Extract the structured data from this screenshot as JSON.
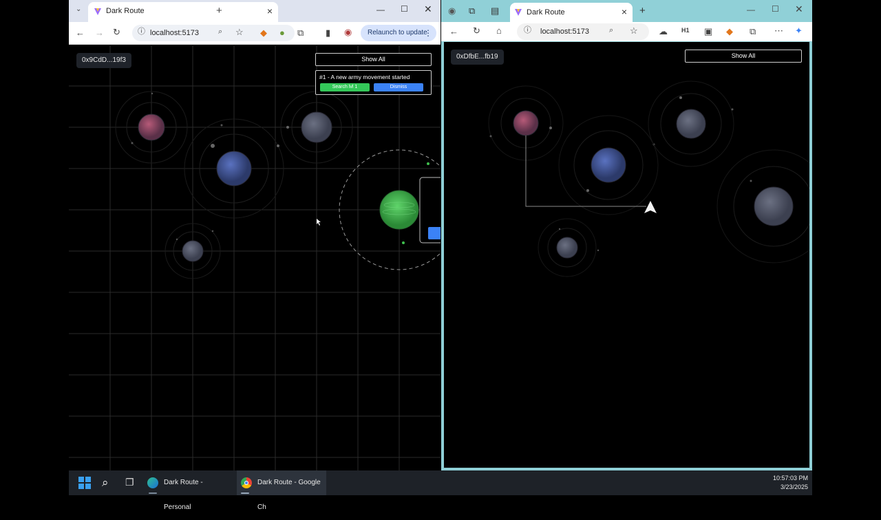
{
  "chrome": {
    "tab_title": "Dark Route",
    "url": "localhost:5173",
    "relaunch_label": "Relaunch to update",
    "game": {
      "address": "0x9CdD...19f3",
      "show_all": "Show All",
      "notification": {
        "message": "#1 - A new army movement started",
        "search_label": "Search lvl 1",
        "dismiss_label": "Dismiss"
      }
    }
  },
  "edge": {
    "tab_title": "Dark Route",
    "url": "localhost:5173",
    "toolbar_badge": "H1",
    "game": {
      "address": "0xDfbE...fb19",
      "show_all": "Show All"
    }
  },
  "taskbar": {
    "apps": [
      {
        "label": "Dark Route - Personal"
      },
      {
        "label": "Dark Route - Google Ch"
      }
    ],
    "time": "10:57:03 PM",
    "date": "3/23/2025"
  },
  "colors": {
    "accent_green": "#34c759",
    "accent_blue": "#3b82f6",
    "planet_red": "#8a3a55",
    "planet_blue": "#3b4f8a",
    "planet_gray": "#4b5162",
    "planet_home": "#3aa64a"
  }
}
